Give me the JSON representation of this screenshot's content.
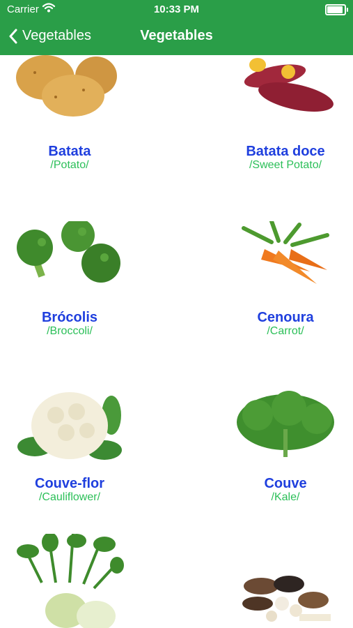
{
  "status_bar": {
    "carrier": "Carrier",
    "time": "10:33 PM",
    "battery_level": 1.0
  },
  "nav": {
    "back_label": "Vegetables",
    "title": "Vegetables"
  },
  "items": [
    {
      "pt": "Batata",
      "en": "/Potato/",
      "icon": "potato-icon"
    },
    {
      "pt": "Batata doce",
      "en": "/Sweet Potato/",
      "icon": "sweet-potato-icon"
    },
    {
      "pt": "Brócolis",
      "en": "/Broccoli/",
      "icon": "broccoli-icon"
    },
    {
      "pt": "Cenoura",
      "en": "/Carrot/",
      "icon": "carrot-icon"
    },
    {
      "pt": "Couve-flor",
      "en": "/Cauliflower/",
      "icon": "cauliflower-icon"
    },
    {
      "pt": "Couve",
      "en": "/Kale/",
      "icon": "kale-icon"
    },
    {
      "pt": "",
      "en": "",
      "icon": "kohlrabi-icon"
    },
    {
      "pt": "",
      "en": "",
      "icon": "mushrooms-icon"
    }
  ]
}
